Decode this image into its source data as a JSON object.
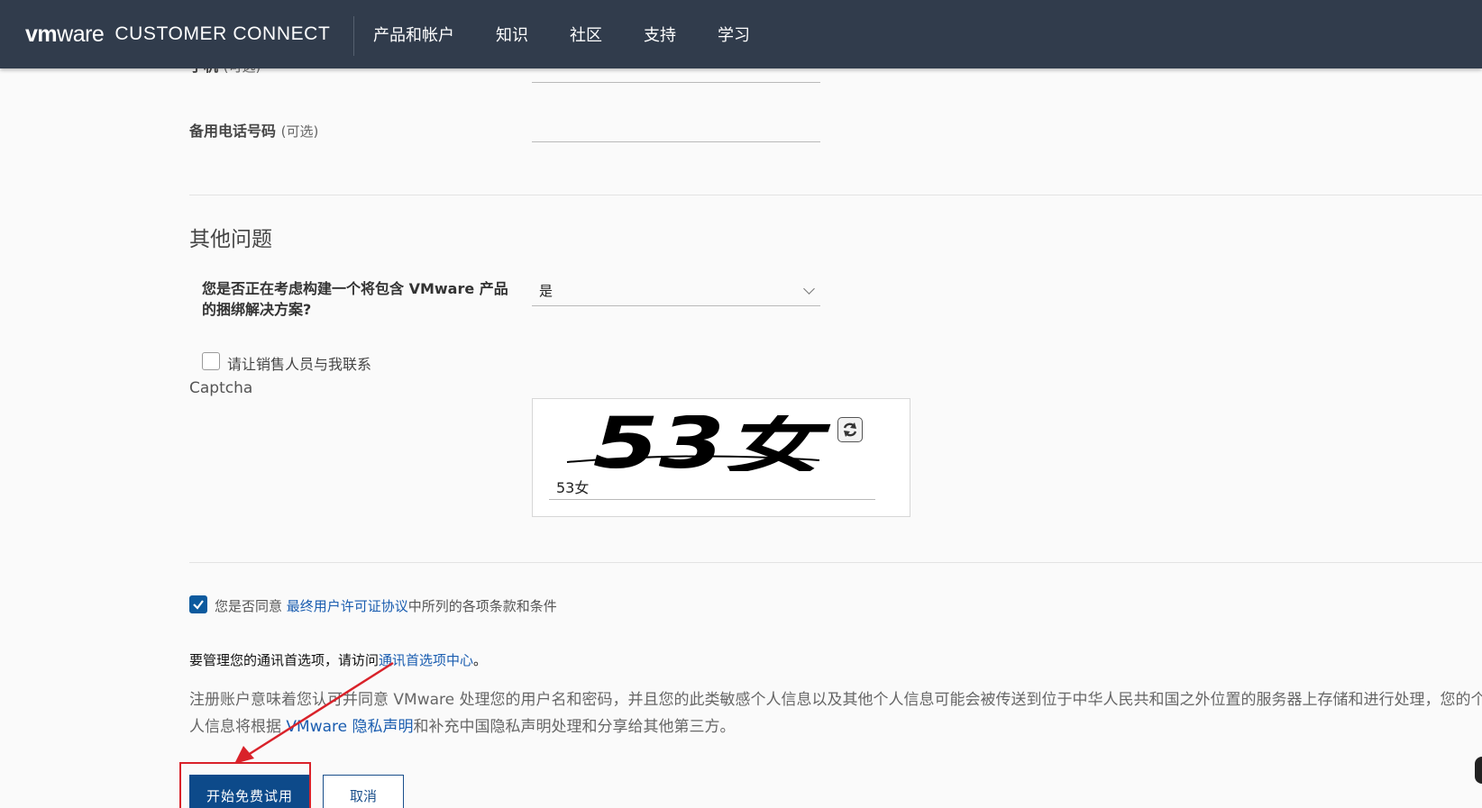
{
  "header": {
    "brand_vm": "vm",
    "brand_ware": "ware",
    "brand_cc": "CUSTOMER CONNECT",
    "nav": [
      "产品和帐户",
      "知识",
      "社区",
      "支持",
      "学习"
    ]
  },
  "form": {
    "cut_label": "手机",
    "cut_label_opt": "(可选)",
    "alt_phone_label": "备用电话号码",
    "alt_phone_opt": "(可选)",
    "alt_phone_value": "",
    "section_title": "其他问题",
    "question_label": "您是否正在考虑构建一个将包含 VMware 产品的捆绑解决方案?",
    "question_value": "是",
    "sales_contact_label": "请让销售人员与我联系",
    "captcha_label": "Captcha",
    "captcha_image_text": "53女",
    "captcha_value": "53女",
    "agree_prefix": "您是否同意 ",
    "agree_link": "最终用户许可证协议",
    "agree_suffix": "中所列的各项条款和条件",
    "prefs_text": "要管理您的通讯首选项，请访问",
    "prefs_link": "通讯首选项中心",
    "prefs_end": "。",
    "privacy_part1": "注册账户意味着您认可并同意 VMware 处理您的用户名和密码，并且您的此类敏感个人信息以及其他个人信息可能会被传送到位于中华人民共和国之外位置的服务器上存储和进行处理，您的个人信息将根据 ",
    "privacy_link": "VMware 隐私声明",
    "privacy_part2": "和补充中国隐私声明处理和分享给其他第三方。",
    "submit_label": "开始免费试用",
    "cancel_label": "取消"
  },
  "colors": {
    "header_bg": "#313c4c",
    "primary": "#0d4a8a",
    "link": "#1a5db0",
    "annotation": "#d9222a"
  },
  "icons": {
    "refresh": "refresh-icon",
    "chevron": "chevron-down-icon",
    "check": "check-icon",
    "arrow": "arrow-annotation"
  }
}
